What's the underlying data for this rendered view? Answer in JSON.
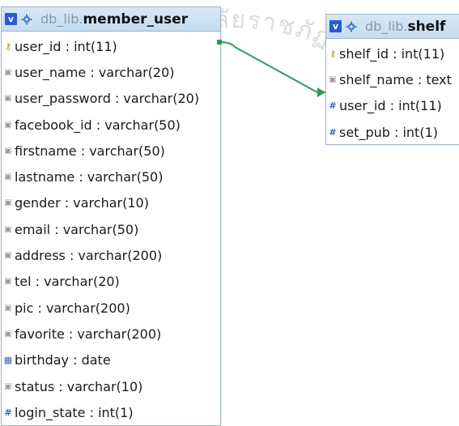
{
  "watermark": {
    "text": "มหาวิทยาลัยราชภัฏมหาสารคาม"
  },
  "tables": {
    "member": {
      "db": "db_lib",
      "dot": ".",
      "name": "member_user",
      "columns": [
        {
          "text": "user_id : int(11)",
          "icon": "primary-key-icon"
        },
        {
          "text": "user_name : varchar(20)",
          "icon": "column-icon"
        },
        {
          "text": "user_password : varchar(20)",
          "icon": "column-icon"
        },
        {
          "text": "facebook_id : varchar(50)",
          "icon": "column-icon"
        },
        {
          "text": "firstname : varchar(50)",
          "icon": "column-icon"
        },
        {
          "text": "lastname : varchar(50)",
          "icon": "column-icon"
        },
        {
          "text": "gender : varchar(10)",
          "icon": "column-icon"
        },
        {
          "text": "email : varchar(50)",
          "icon": "column-icon"
        },
        {
          "text": "address : varchar(200)",
          "icon": "column-icon"
        },
        {
          "text": "tel : varchar(20)",
          "icon": "column-icon"
        },
        {
          "text": "pic : varchar(200)",
          "icon": "column-icon"
        },
        {
          "text": "favorite : varchar(200)",
          "icon": "column-icon"
        },
        {
          "text": "birthday : date",
          "icon": "date-icon"
        },
        {
          "text": "status : varchar(10)",
          "icon": "column-icon"
        },
        {
          "text": "login_state : int(1)",
          "icon": "number-icon"
        }
      ]
    },
    "shelf": {
      "db": "db_lib",
      "dot": ".",
      "name": "shelf",
      "columns": [
        {
          "text": "shelf_id : int(11)",
          "icon": "primary-key-icon"
        },
        {
          "text": "shelf_name : text",
          "icon": "column-icon"
        },
        {
          "text": "user_id : int(11)",
          "icon": "number-icon"
        },
        {
          "text": "set_pub : int(1)",
          "icon": "number-icon"
        }
      ]
    }
  },
  "colors": {
    "header": "#c6dcef",
    "relation": "#2e9a5a",
    "border": "#9fb5c9"
  }
}
